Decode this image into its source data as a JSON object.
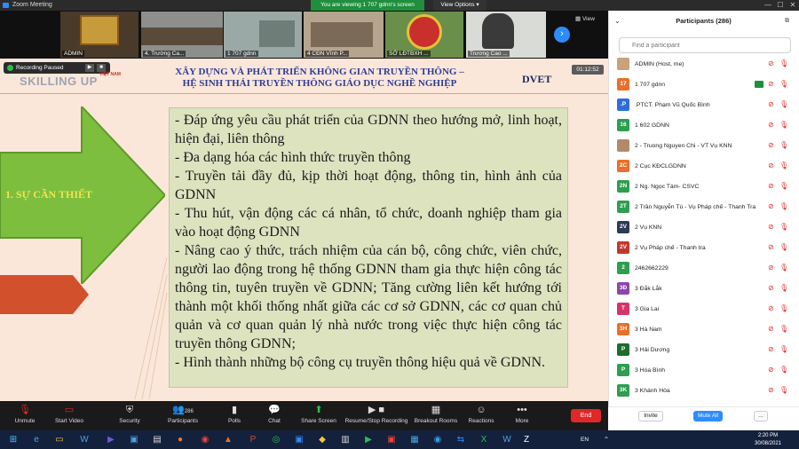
{
  "window": {
    "title": "Zoom Meeting",
    "viewing_banner": "You are viewing 1 707 gdnn's screen",
    "view_options": "View Options ▾",
    "minimize": "—",
    "maximize": "☐",
    "close": "✕"
  },
  "strip": {
    "thumbnails": [
      {
        "name": "ADMIN"
      },
      {
        "name": "4. Trường Ca..."
      },
      {
        "name": "1 707 gdnn"
      },
      {
        "name": "4 CĐN Vĩnh P..."
      },
      {
        "name": "SỞ LĐTBXH ..."
      },
      {
        "name": "Trương Cao ..."
      }
    ],
    "next_label": "›",
    "view_label": "View"
  },
  "recording": {
    "status": "Recording Paused",
    "play": "▶",
    "stop": "■"
  },
  "slide": {
    "logo_text": "SKILLING UP",
    "logo_sub": "VIỆT NAM",
    "title_line1": "XÂY DỰNG VÀ PHÁT TRIỂN KHÔNG GIAN TRUYỀN THÔNG –",
    "title_line2": "HỆ SINH THÁI TRUYỀN THÔNG GIÁO DỤC NGHỀ NGHIỆP",
    "brand": "DVET",
    "timer": "01:12:52",
    "section_label": "1. SỰ CẦN THIẾT",
    "bullets": [
      "- Đáp ứng yêu cầu phát triển của GDNN theo hướng mở, linh hoạt, hiện đại, liên thông",
      "- Đa dạng hóa các hình thức truyền thông",
      "- Truyền tải đầy đủ, kịp thời hoạt động, thông tin, hình ảnh của GDNN",
      "- Thu hút, vận động các cá nhân, tổ chức, doanh nghiệp tham gia vào hoạt động GDNN",
      "- Nâng cao ý thức, trách nhiệm của cán bộ, công chức, viên chức, người lao động trong hệ thống GDNN tham gia thực hiện công tác thông tin, tuyên truyền về GDNN; Tăng cường liên kết hướng tới thành một khối thống nhất giữa các cơ sở GDNN, các cơ quan chủ quản và cơ quan quản lý nhà nước trong việc thực hiện công tác truyền thông GDNN;",
      "- Hình thành những bộ công cụ truyền thông hiệu quả về GDNN."
    ]
  },
  "toolbar": {
    "unmute": "Unmute",
    "start_video": "Start Video",
    "security": "Security",
    "participants": "Participants",
    "participants_count": "286",
    "polls": "Polls",
    "chat": "Chat",
    "share_screen": "Share Screen",
    "record": "Resume/Stop Recording",
    "breakout": "Breakout Rooms",
    "reactions": "Reactions",
    "more": "More",
    "end": "End"
  },
  "panel": {
    "title": "Participants (286)",
    "search_placeholder": "Find a participant",
    "participants": [
      {
        "initials": "",
        "name": "ADMIN (Host, me)",
        "color": "#c8a27a",
        "screen": false
      },
      {
        "initials": "17",
        "name": "1 707 gdnn",
        "color": "#e8702a",
        "screen": true
      },
      {
        "initials": ".P",
        "name": ".PTCT. Phạm Vũ Quốc Bình",
        "color": "#2d6fd6",
        "screen": false
      },
      {
        "initials": "16",
        "name": "1 602 GDNN",
        "color": "#2e9e4f",
        "screen": false
      },
      {
        "initials": "",
        "name": "2 - Truong Nguyen Chi - VT Vụ KNN",
        "color": "#b08a6a",
        "screen": false
      },
      {
        "initials": "2C",
        "name": "2 Cục KĐCLGDNN",
        "color": "#e8702a",
        "screen": false
      },
      {
        "initials": "2N",
        "name": "2 Ng. Ngọc Tám- CSVC",
        "color": "#2e9e4f",
        "screen": false
      },
      {
        "initials": "2T",
        "name": "2 Trần Nguyễn Tú - Vụ Pháp chế - Thanh Tra",
        "color": "#2e9e4f",
        "screen": false
      },
      {
        "initials": "2V",
        "name": "2 Vụ KNN",
        "color": "#2b3a55",
        "screen": false
      },
      {
        "initials": "2V",
        "name": "2 Vụ Pháp chế - Thanh tra",
        "color": "#c0392b",
        "screen": false
      },
      {
        "initials": "2",
        "name": "2462662229",
        "color": "#2e9e4f",
        "screen": false
      },
      {
        "initials": "3Đ",
        "name": "3 Đắk Lắk",
        "color": "#8e44ad",
        "screen": false
      },
      {
        "initials": "T",
        "name": "3 Gia Lai",
        "color": "#d6336c",
        "screen": false
      },
      {
        "initials": "3H",
        "name": "3 Hà Nam",
        "color": "#e8702a",
        "screen": false
      },
      {
        "initials": "P",
        "name": "3 Hải Dương",
        "color": "#1e6b2f",
        "screen": false
      },
      {
        "initials": "P",
        "name": "3 Hòa Bình",
        "color": "#2e9e4f",
        "screen": false
      },
      {
        "initials": "3K",
        "name": "3 Khánh Hòa",
        "color": "#2e9e4f",
        "screen": false
      }
    ],
    "invite": "Invite",
    "mute_all": "Mute All",
    "more": "..."
  },
  "taskbar": {
    "language": "EN",
    "time": "2:20 PM",
    "date": "30/08/2021"
  }
}
